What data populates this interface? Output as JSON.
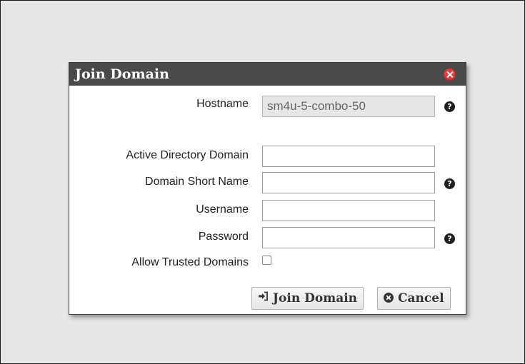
{
  "dialog": {
    "title": "Join Domain",
    "hostname": {
      "label": "Hostname",
      "value": "sm4u-5-combo-50"
    },
    "ad_domain": {
      "label": "Active Directory Domain",
      "value": ""
    },
    "short_name": {
      "label": "Domain Short Name",
      "value": ""
    },
    "username": {
      "label": "Username",
      "value": ""
    },
    "password": {
      "label": "Password",
      "value": ""
    },
    "allow_trusted": {
      "label": "Allow Trusted Domains",
      "checked": false
    },
    "help_glyph": "?",
    "buttons": {
      "join_label": "Join Domain",
      "cancel_label": "Cancel"
    },
    "icons": {
      "close": "close-circle-icon",
      "help": "question-circle-icon",
      "join": "sign-in-icon",
      "cancel": "times-circle-icon"
    },
    "colors": {
      "titlebar": "#4a4a4a",
      "close": "#e53b3b"
    }
  }
}
